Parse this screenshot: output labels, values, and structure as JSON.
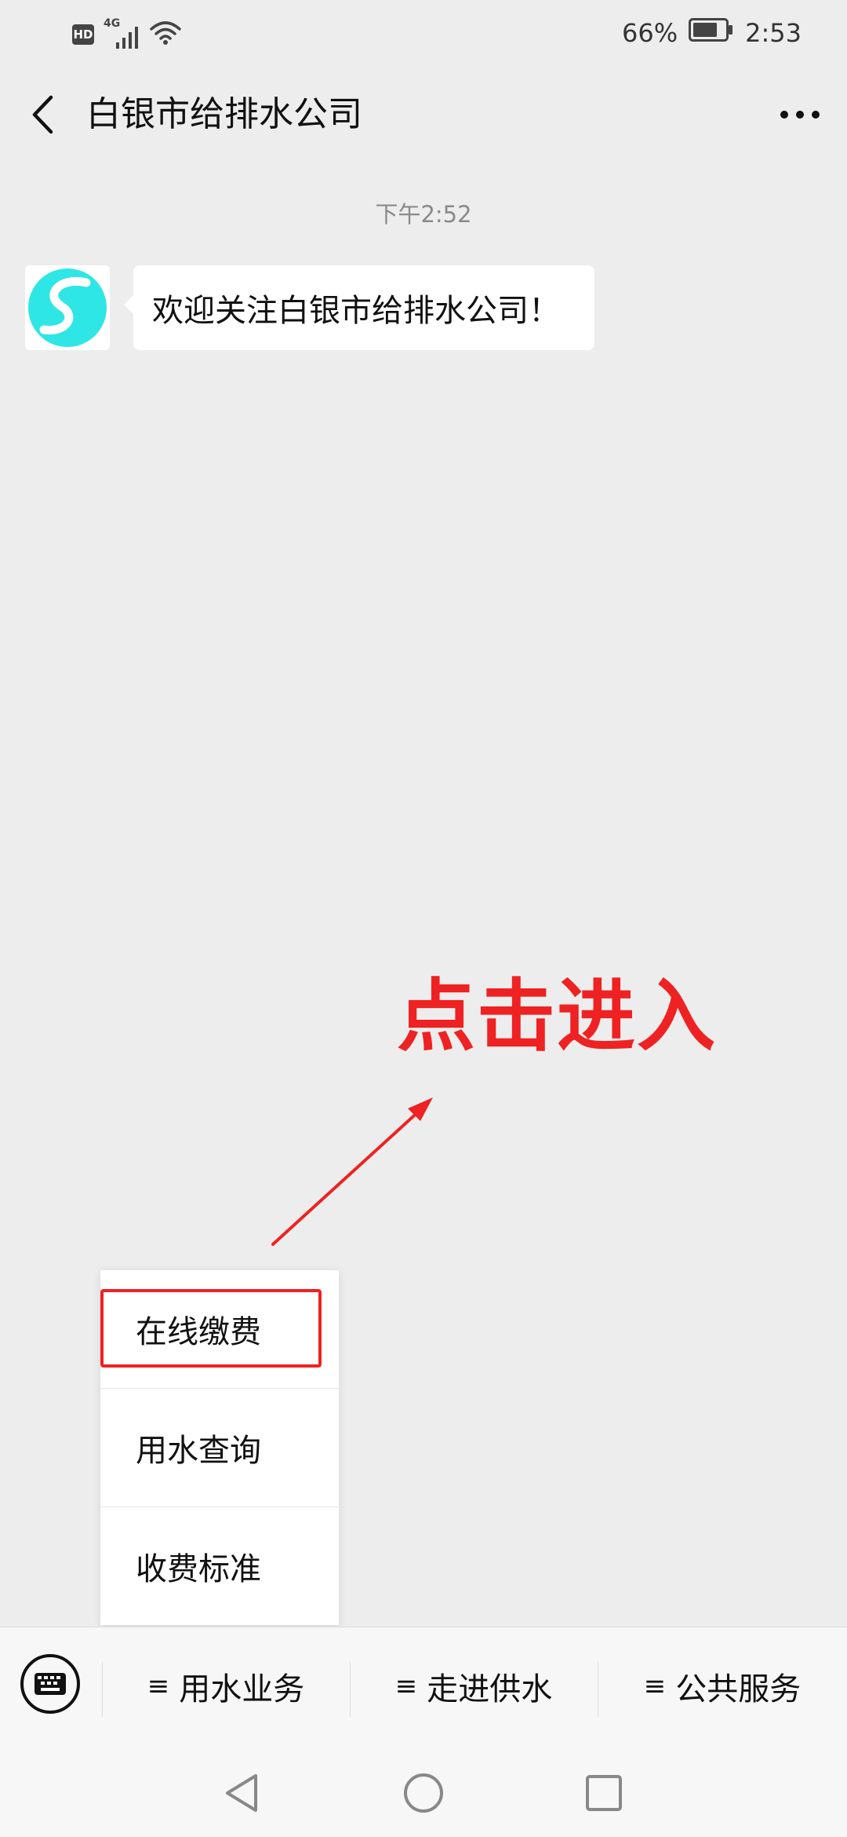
{
  "status_bar": {
    "hd": "HD",
    "network": "4G",
    "battery": "66%",
    "time": "2:53"
  },
  "header": {
    "title": "白银市给排水公司",
    "back_icon": "chevron-left-icon",
    "more_icon": "ellipsis-icon"
  },
  "chat": {
    "timestamp": "下午2:52",
    "messages": [
      {
        "sender_icon": "company-logo",
        "text": "欢迎关注白银市给排水公司！"
      }
    ]
  },
  "annotation": {
    "text": "点击进入",
    "color": "#ee2222"
  },
  "popup_menu": {
    "items": [
      {
        "label": "在线缴费",
        "highlighted": true
      },
      {
        "label": "用水查询"
      },
      {
        "label": "收费标准"
      }
    ]
  },
  "menu_bar": {
    "keyboard_icon": "keyboard-icon",
    "tabs": [
      {
        "label": "用水业务"
      },
      {
        "label": "走进供水"
      },
      {
        "label": "公共服务"
      }
    ]
  },
  "nav_bar": {
    "back_icon": "triangle-back-icon",
    "home_icon": "circle-home-icon",
    "recent_icon": "square-recent-icon"
  },
  "colors": {
    "background": "#ededed",
    "bubble": "#ffffff",
    "accent_red": "#ee2222",
    "logo_cyan": "#2ee6e6"
  }
}
